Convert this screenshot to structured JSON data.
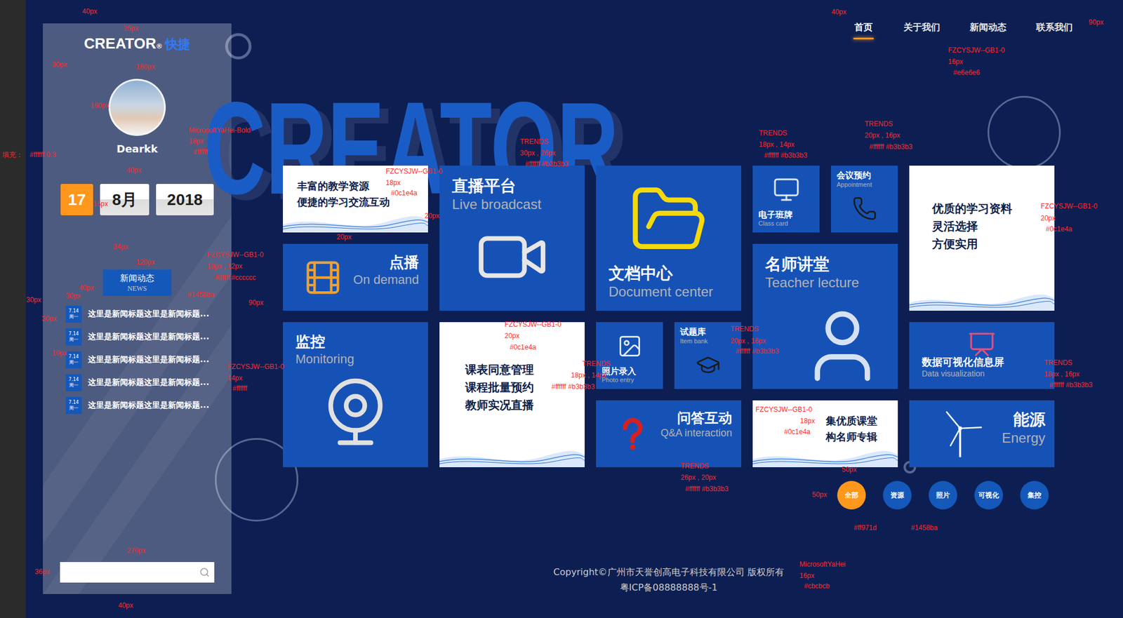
{
  "logo": {
    "text": "CREATOR",
    "mark": "®",
    "accent": "快捷"
  },
  "user": {
    "name": "Dearkk"
  },
  "date": {
    "day": "17",
    "month": "8月",
    "year": "2018"
  },
  "news": {
    "title": "新闻动态",
    "subtitle": "NEWS",
    "items": [
      {
        "date": "7.14",
        "weekday": "周一",
        "title": "这里是新闻标题这里是新闻标题..."
      },
      {
        "date": "7.14",
        "weekday": "周一",
        "title": "这里是新闻标题这里是新闻标题..."
      },
      {
        "date": "7.14",
        "weekday": "周一",
        "title": "这里是新闻标题这里是新闻标题..."
      },
      {
        "date": "7.14",
        "weekday": "周一",
        "title": "这里是新闻标题这里是新闻标题..."
      },
      {
        "date": "7.14",
        "weekday": "周一",
        "title": "这里是新闻标题这里是新闻标题..."
      }
    ]
  },
  "nav": [
    {
      "label": "首页",
      "selected": true
    },
    {
      "label": "关于我们",
      "selected": false
    },
    {
      "label": "新闻动态",
      "selected": false
    },
    {
      "label": "联系我们",
      "selected": false
    }
  ],
  "watermark": "CREATOR",
  "tiles": [
    {
      "kind": "text",
      "lines": [
        "丰富的教学资源",
        "便捷的学习交流互动"
      ]
    },
    {
      "kind": "feature",
      "title": "直播平台",
      "subtitle": "Live broadcast"
    },
    {
      "kind": "feature",
      "title": "文档中心",
      "subtitle": "Document center"
    },
    {
      "kind": "small",
      "title": "电子班牌",
      "subtitle": "Class card"
    },
    {
      "kind": "small",
      "title": "会议预约",
      "subtitle": "Appointment"
    },
    {
      "kind": "text",
      "lines": [
        "优质的学习资料",
        "灵活选择",
        "方便实用"
      ]
    },
    {
      "kind": "feature",
      "title": "点播",
      "subtitle": "On demand"
    },
    {
      "kind": "feature",
      "title": "名师讲堂",
      "subtitle": "Teacher lecture"
    },
    {
      "kind": "feature",
      "title": "监控",
      "subtitle": "Monitoring"
    },
    {
      "kind": "text",
      "lines": [
        "课表同意管理",
        "课程批量预约",
        "教师实况直播"
      ]
    },
    {
      "kind": "small",
      "title": "照片录入",
      "subtitle": "Photo entry"
    },
    {
      "kind": "small",
      "title": "试题库",
      "subtitle": "Item bank"
    },
    {
      "kind": "feature",
      "title": "数据可视化信息屏",
      "subtitle": "Data visualization"
    },
    {
      "kind": "feature",
      "title": "问答互动",
      "subtitle": "Q&A interaction"
    },
    {
      "kind": "text",
      "lines": [
        "集优质课堂",
        "构名师专辑"
      ]
    },
    {
      "kind": "feature",
      "title": "能源",
      "subtitle": "Energy"
    }
  ],
  "filters": [
    {
      "label": "全部",
      "selected": true
    },
    {
      "label": "资源",
      "selected": false
    },
    {
      "label": "照片",
      "selected": false
    },
    {
      "label": "可视化",
      "selected": false
    },
    {
      "label": "集控",
      "selected": false
    }
  ],
  "footer": [
    "Copyright©广州市天誉创高电子科技有限公司 版权所有",
    "粤ICP备08888888号-1"
  ],
  "annotations": [
    "40px",
    "25px",
    "30px",
    "160px",
    "160px",
    "MicrosoftYaHei-Bold",
    "18px",
    "#ffffff",
    "填充：",
    "#ffffff  0.3",
    "40px",
    "15px",
    "34px",
    "120px",
    "FZCYSJW--GB1-0",
    "18px , 12px",
    "#ffffff  #cccccc",
    "40px",
    "#1458ba",
    "30px",
    "30px",
    "30px",
    "10px",
    "90px",
    "FZCYSJW--GB1-0",
    "14px",
    "#ffffff",
    "270px",
    "36px",
    "40px",
    "40px",
    "FZCYSJW--GB1-0",
    "16px",
    "#e6e6e6",
    "90px",
    "FZCYSJW--GB1-0",
    "18px",
    "#0c1e4a",
    "TRENDS",
    "30px , 26px",
    "#ffffff  #b3b3b3",
    "20px",
    "20px",
    "TRENDS",
    "18px , 14px",
    "#ffffff  #b3b3b3",
    "TRENDS",
    "20px , 16px",
    "#ffffff  #b3b3b3",
    "FZCYSJW--GB1-0",
    "20px",
    "#0c1e4a",
    "FZCYSJW--GB1-0",
    "20px",
    "#0c1e4a",
    "TRENDS",
    "18px , 14px",
    "#ffffff  #b3b3b3",
    "TRENDS",
    "20px , 16px",
    "#ffffff  #b3b3b3",
    "TRENDS",
    "18px , 16px",
    "#ffffff  #b3b3b3",
    "FZCYSJW--GB1-0",
    "18px",
    "#0c1e4a",
    "TRENDS",
    "26px , 20px",
    "#ffffff  #b3b3b3",
    "50px",
    "50px",
    "#ff971d",
    "#1458ba",
    "MicrosoftYaHei",
    "16px",
    "#cbcbcb"
  ]
}
